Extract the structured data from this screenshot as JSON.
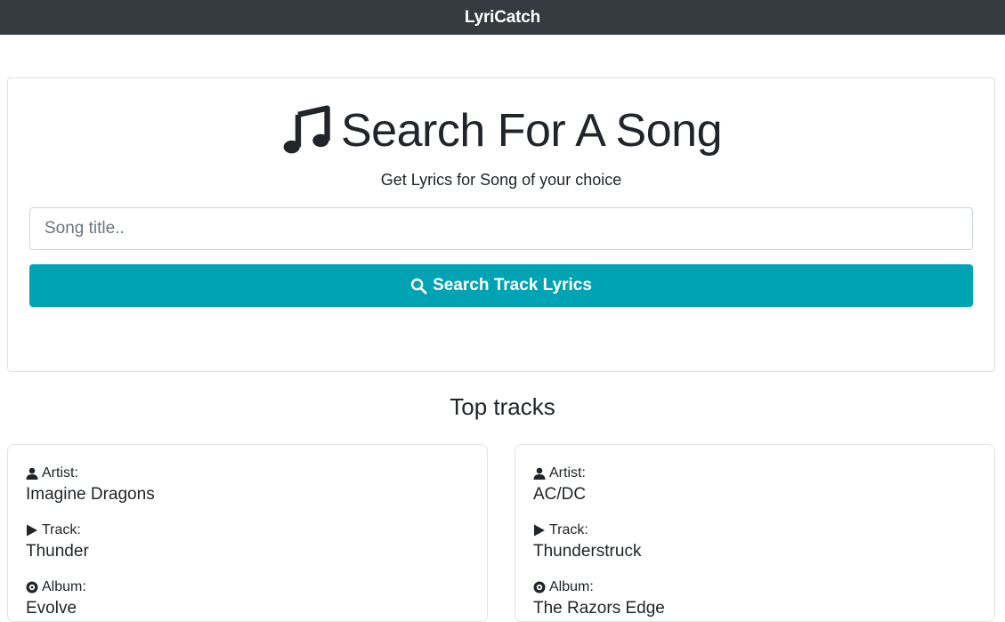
{
  "navbar": {
    "brand": "LyriCatch"
  },
  "search": {
    "title": "Search For A Song",
    "subtitle": "Get Lyrics for Song of your choice",
    "input_placeholder": "Song title..",
    "input_value": "",
    "button_label": "Search Track Lyrics"
  },
  "top_tracks": {
    "heading": "Top tracks",
    "items": [
      {
        "artist_label": "Artist:",
        "artist": "Imagine Dragons",
        "track_label": "Track:",
        "track": "Thunder",
        "album_label": "Album:",
        "album": "Evolve"
      },
      {
        "artist_label": "Artist:",
        "artist": "AC/DC",
        "track_label": "Track:",
        "track": "Thunderstruck",
        "album_label": "Album:",
        "album": "The Razors Edge"
      }
    ]
  },
  "colors": {
    "navbar_bg": "#343a40",
    "button_bg": "#00a3b4",
    "text": "#212529"
  },
  "icons": {
    "heading": "music-note-icon",
    "button": "search-icon",
    "artist": "user-icon",
    "track": "play-icon",
    "album": "disc-icon"
  }
}
